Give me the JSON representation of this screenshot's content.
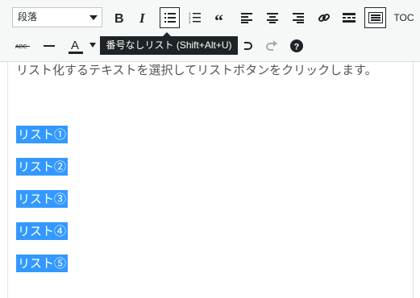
{
  "toolbar": {
    "format_select": "段落",
    "toc_label": "TOC",
    "tooltip": "番号なしリスト (Shift+Alt+U)"
  },
  "editor": {
    "paragraph": "リスト化するテキストを選択してリストボタンをクリックします。",
    "list_items": [
      "リスト①",
      "リスト②",
      "リスト③",
      "リスト④",
      "リスト⑤"
    ]
  }
}
